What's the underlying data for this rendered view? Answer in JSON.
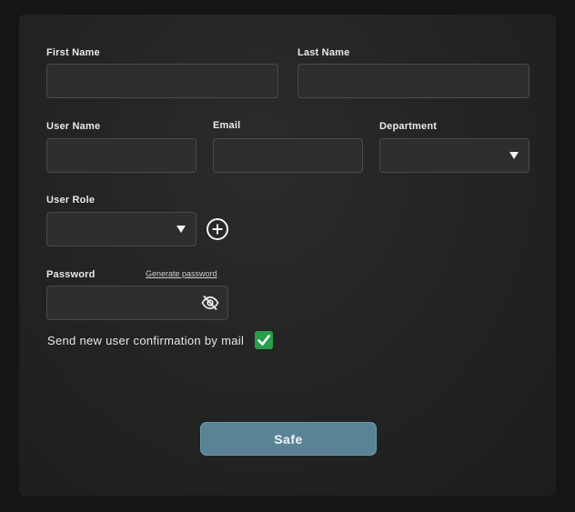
{
  "form": {
    "first_name": {
      "label": "First Name",
      "value": ""
    },
    "last_name": {
      "label": "Last Name",
      "value": ""
    },
    "user_name": {
      "label": "User Name",
      "value": ""
    },
    "email": {
      "label": "Email",
      "value": ""
    },
    "department": {
      "label": "Department",
      "selected": ""
    },
    "user_role": {
      "label": "User Role",
      "selected": ""
    },
    "password": {
      "label": "Password",
      "value": "",
      "generate_link": "Generate password"
    },
    "confirmation": {
      "label": "Send new user confirmation by mail",
      "checked": true
    },
    "save_label": "Safe"
  },
  "icons": {
    "add_role": "plus-circle-icon",
    "password_visibility": "eye-off-icon",
    "dropdown": "caret-down-icon",
    "checkmark": "check-icon"
  },
  "colors": {
    "background": "#151515",
    "panel": "#242424",
    "field": "#2e2e2e",
    "checkbox": "#2a9d4a",
    "button": "#5a8496"
  }
}
